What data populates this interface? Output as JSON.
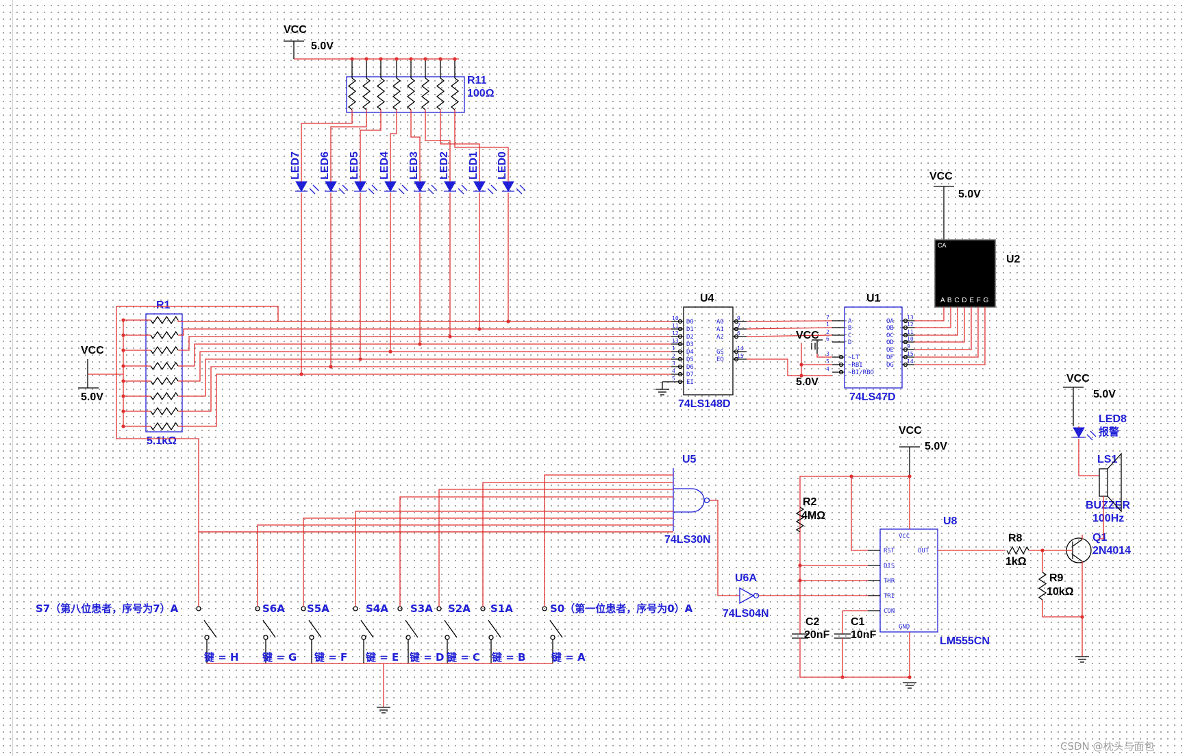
{
  "vcc": {
    "label": "VCC",
    "voltage": "5.0V"
  },
  "resistor_network_r11": {
    "ref": "R11",
    "value": "100Ω"
  },
  "resistor_network_r1": {
    "ref": "R1",
    "value": "5.1kΩ"
  },
  "leds": [
    "LED7",
    "LED6",
    "LED5",
    "LED4",
    "LED3",
    "LED2",
    "LED1",
    "LED0"
  ],
  "u4": {
    "ref": "U4",
    "part": "74LS148D",
    "left_pins": [
      "D0",
      "D1",
      "D2",
      "D3",
      "D4",
      "D5",
      "D6",
      "D7",
      "EI"
    ],
    "left_nums": [
      "10",
      "11",
      "12",
      "13",
      "1",
      "2",
      "3",
      "4",
      "5"
    ],
    "right_pins": [
      "A0",
      "A1",
      "A2",
      "GS",
      "EO"
    ],
    "right_nums": [
      "9",
      "7",
      "6",
      "14",
      "15"
    ]
  },
  "u1": {
    "ref": "U1",
    "part": "74LS47D",
    "left_pins": [
      "A",
      "B",
      "C",
      "D",
      "~LT",
      "~RBI",
      "~BI/RBO"
    ],
    "left_nums": [
      "7",
      "1",
      "2",
      "6",
      "3",
      "5",
      "4"
    ],
    "right_pins": [
      "OA",
      "OB",
      "OC",
      "OD",
      "OE",
      "OF",
      "OG"
    ],
    "right_nums": [
      "13",
      "12",
      "11",
      "10",
      "9",
      "15",
      "14"
    ]
  },
  "u2": {
    "ref": "U2",
    "common": "CA",
    "segments": "A B C D E F G"
  },
  "u5": {
    "ref": "U5",
    "part": "74LS30N"
  },
  "u6": {
    "ref": "U6A",
    "part": "74LS04N"
  },
  "u8": {
    "ref": "U8",
    "part": "LM555CN",
    "pins": [
      "VCC",
      "RST",
      "OUT",
      "DIS",
      "THR",
      "TRI",
      "CON",
      "GND"
    ]
  },
  "r2": {
    "ref": "R2",
    "value": "4MΩ"
  },
  "c2": {
    "ref": "C2",
    "value": "20nF"
  },
  "c1": {
    "ref": "C1",
    "value": "10nF"
  },
  "r8": {
    "ref": "R8",
    "value": "1kΩ"
  },
  "r9": {
    "ref": "R9",
    "value": "10kΩ"
  },
  "q1": {
    "ref": "Q1",
    "part": "2N4014"
  },
  "led8": {
    "ref": "LED8",
    "note": "报警"
  },
  "ls1": {
    "ref": "LS1",
    "part": "BUZZER",
    "freq": "100Hz"
  },
  "switches": [
    {
      "ref": "S7（第八位患者，序号为7）A",
      "key": "键 = H"
    },
    {
      "ref": "S6A",
      "key": "键 = G"
    },
    {
      "ref": "S5A",
      "key": "键 = F"
    },
    {
      "ref": "S4A",
      "key": "键 = E"
    },
    {
      "ref": "S3A",
      "key": "键 = D"
    },
    {
      "ref": "S2A",
      "key": "键 = C"
    },
    {
      "ref": "S1A",
      "key": "键 = B"
    },
    {
      "ref": "S0（第一位患者，序号为0）A",
      "key": "键 = A"
    }
  ],
  "watermark": "CSDN @枕头与面包"
}
